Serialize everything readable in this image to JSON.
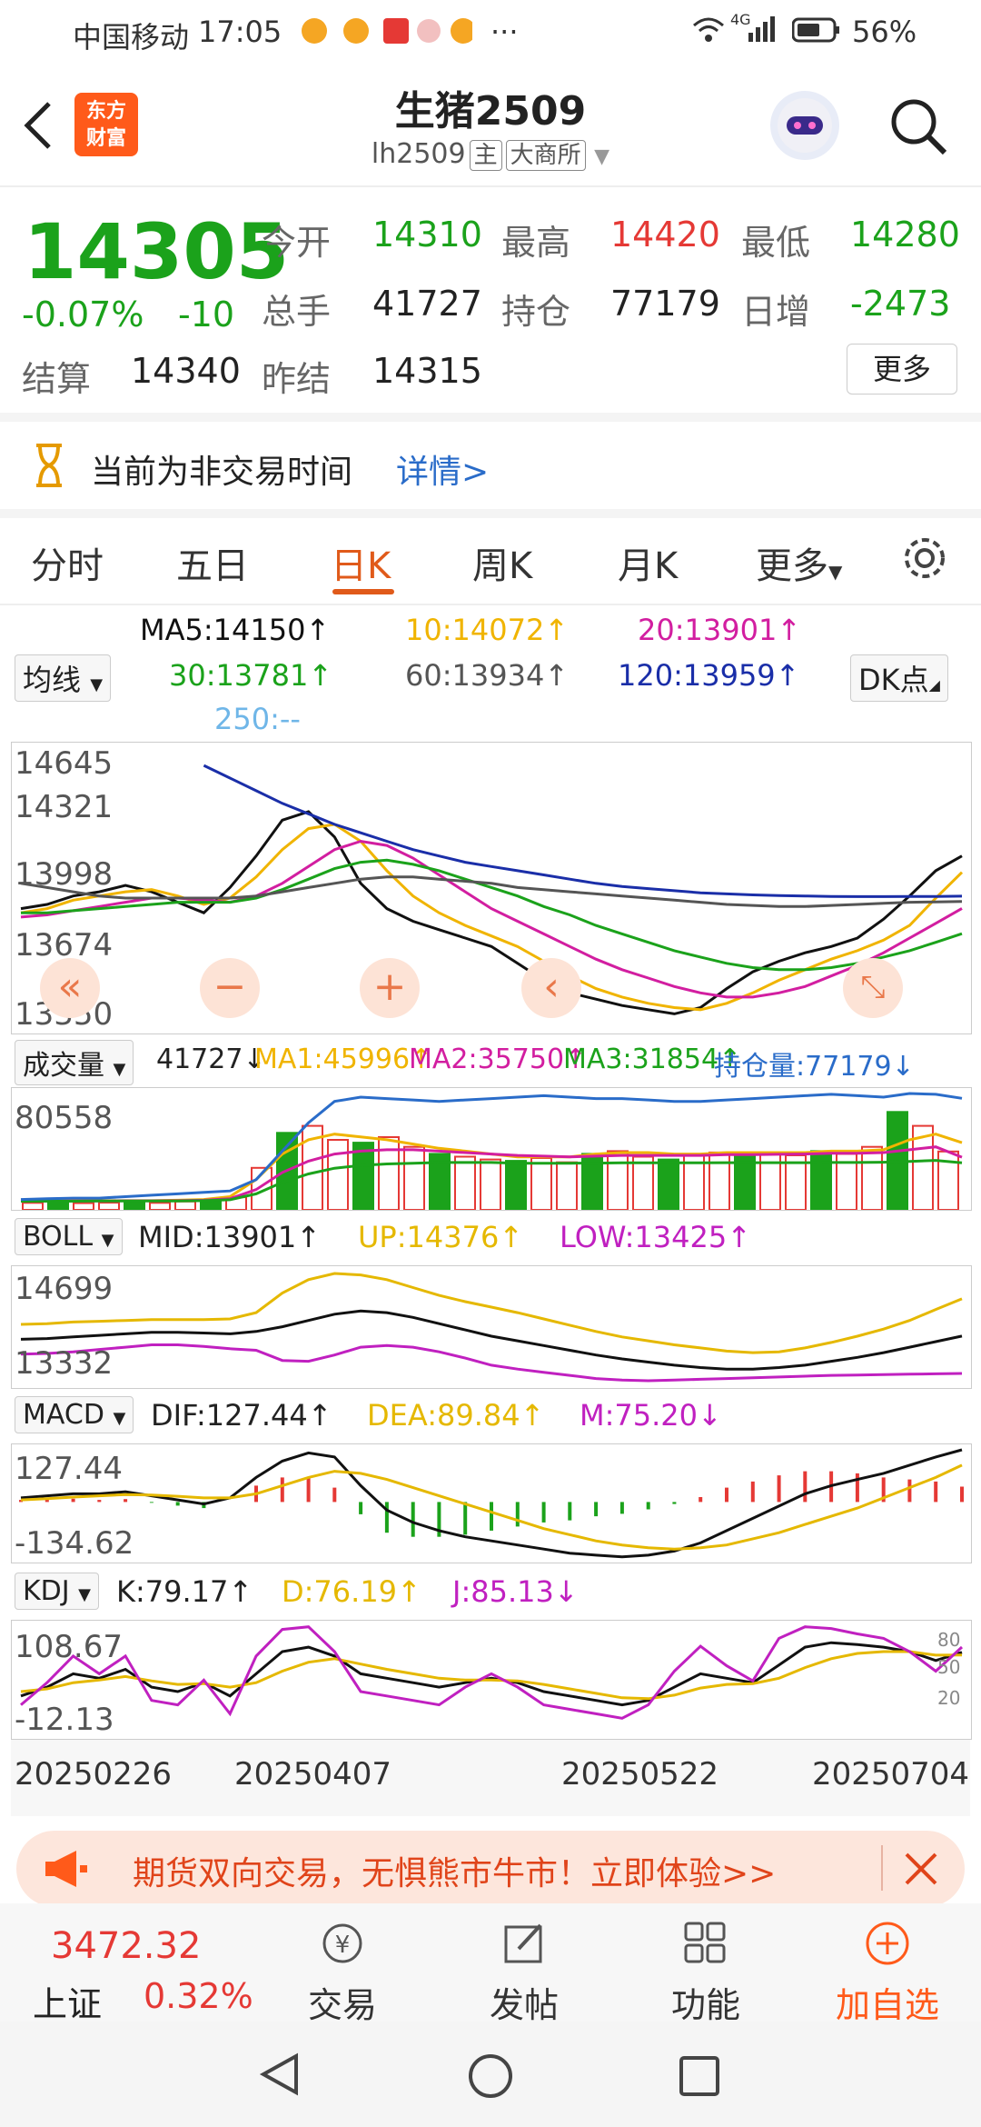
{
  "status_bar": {
    "carrier": "中国移动",
    "time": "17:05",
    "more": "···",
    "network": "4G",
    "battery": "56%"
  },
  "header": {
    "logo_line1": "东方",
    "logo_line2": "财富",
    "title": "生猪2509",
    "code": "lh2509",
    "tag_main": "主",
    "exchange": "大商所"
  },
  "quote": {
    "price": "14305",
    "change_pct": "-0.07%",
    "change": "-10",
    "open_label": "今开",
    "open": "14310",
    "high_label": "最高",
    "high": "14420",
    "low_label": "最低",
    "low": "14280",
    "volume_label": "总手",
    "volume": "41727",
    "oi_label": "持仓",
    "oi": "77179",
    "oi_chg_label": "日增",
    "oi_chg": "-2473",
    "settle_label": "结算",
    "settle": "14340",
    "prev_settle_label": "昨结",
    "prev_settle": "14315",
    "more_button": "更多"
  },
  "notice": {
    "text": "当前为非交易时间",
    "link": "详情>"
  },
  "tabs": [
    "分时",
    "五日",
    "日K",
    "周K",
    "月K",
    "更多"
  ],
  "active_tab": "日K",
  "ma": {
    "selector": "均线",
    "ma5": "MA5:14150↑",
    "ma10": "10:14072↑",
    "ma20": "20:13901↑",
    "ma30": "30:13781↑",
    "ma60": "60:13934↑",
    "ma120": "120:13959↑",
    "ma250": "250:--",
    "dk": "DK点",
    "colors": {
      "ma5": "#111111",
      "ma10": "#f0b400",
      "ma20": "#d21ea0",
      "ma30": "#1ba21b",
      "ma60": "#555555",
      "ma120": "#1a2ea8",
      "ma250": "#6fb6e8"
    }
  },
  "kline_axis": {
    "y_top": "14645",
    "y_2": "14321",
    "y_3": "13998",
    "y_4": "13674",
    "y_bottom": "13350"
  },
  "volume": {
    "selector": "成交量",
    "vol": "41727↓",
    "ma1": "MA1:45996↑",
    "ma2": "MA2:35750↑",
    "ma3": "MA3:31854↑",
    "oi": "持仓量:77179↓",
    "y_top": "80558"
  },
  "boll": {
    "selector": "BOLL",
    "mid": "MID:13901↑",
    "up": "UP:14376↑",
    "low": "LOW:13425↑",
    "y_top": "14699",
    "y_bottom": "13332"
  },
  "macd": {
    "selector": "MACD",
    "dif": "DIF:127.44↑",
    "dea": "DEA:89.84↑",
    "m": "M:75.20↓",
    "y_top": "127.44",
    "y_bottom": "-134.62"
  },
  "kdj": {
    "selector": "KDJ",
    "k": "K:79.17↑",
    "d": "D:76.19↑",
    "j": "J:85.13↓",
    "y_top": "108.67",
    "y_bottom": "-12.13",
    "r80": "80",
    "r50": "50",
    "r20": "20"
  },
  "x_dates": [
    "20250226",
    "20250407",
    "20250522",
    "20250704"
  ],
  "banner": {
    "text": "期货双向交易，无惧熊市牛市！立即体验>>"
  },
  "bottom_nav": {
    "index_value": "3472.32",
    "index_name": "上证",
    "index_change": "0.32%",
    "trade": "交易",
    "post": "发帖",
    "function": "功能",
    "add_fav": "加自选"
  },
  "chart_data": [
    {
      "type": "line",
      "title": "",
      "ylim": [
        13350,
        14645
      ],
      "x_ticks": [
        "20250226",
        "20250407",
        "20250522",
        "20250704"
      ],
      "series": [
        {
          "name": "MA5",
          "values": [
            13900,
            13920,
            13960,
            13980,
            14010,
            13980,
            13930,
            13880,
            14000,
            14150,
            14320,
            14360,
            14240,
            14020,
            13900,
            13840,
            13800,
            13760,
            13720,
            13640,
            13560,
            13500,
            13470,
            13440,
            13420,
            13400,
            13430,
            13520,
            13600,
            13650,
            13690,
            13720,
            13760,
            13850,
            13960,
            14080,
            14150
          ]
        },
        {
          "name": "10",
          "values": [
            13880,
            13900,
            13940,
            13960,
            13980,
            13990,
            13960,
            13920,
            13950,
            14050,
            14180,
            14280,
            14300,
            14220,
            14080,
            13960,
            13880,
            13820,
            13770,
            13720,
            13650,
            13580,
            13520,
            13480,
            13450,
            13430,
            13420,
            13450,
            13500,
            13560,
            13610,
            13660,
            13700,
            13750,
            13820,
            13950,
            14072
          ]
        },
        {
          "name": "20",
          "values": [
            13860,
            13870,
            13890,
            13910,
            13930,
            13950,
            13950,
            13940,
            13930,
            13960,
            14020,
            14100,
            14180,
            14220,
            14200,
            14140,
            14060,
            13980,
            13900,
            13840,
            13780,
            13720,
            13660,
            13610,
            13570,
            13530,
            13500,
            13480,
            13480,
            13500,
            13530,
            13580,
            13630,
            13690,
            13760,
            13830,
            13901
          ]
        },
        {
          "name": "30",
          "values": [
            13880,
            13880,
            13890,
            13900,
            13910,
            13920,
            13930,
            13930,
            13930,
            13950,
            13990,
            14040,
            14090,
            14120,
            14130,
            14110,
            14080,
            14040,
            14000,
            13960,
            13910,
            13870,
            13820,
            13780,
            13740,
            13700,
            13670,
            13640,
            13620,
            13610,
            13610,
            13620,
            13640,
            13670,
            13700,
            13740,
            13781
          ]
        },
        {
          "name": "60",
          "values": [
            14020,
            14000,
            13980,
            13960,
            13950,
            13950,
            13950,
            13950,
            13950,
            13960,
            13980,
            14000,
            14020,
            14040,
            14050,
            14050,
            14040,
            14030,
            14020,
            14000,
            13990,
            13980,
            13970,
            13960,
            13950,
            13940,
            13930,
            13920,
            13915,
            13910,
            13910,
            13915,
            13920,
            13925,
            13930,
            13932,
            13934
          ]
        },
        {
          "name": "120",
          "values": [
            null,
            null,
            null,
            null,
            null,
            null,
            null,
            14580,
            14520,
            14460,
            14400,
            14350,
            14300,
            14260,
            14220,
            14180,
            14150,
            14120,
            14100,
            14080,
            14060,
            14040,
            14020,
            14005,
            13995,
            13985,
            13975,
            13970,
            13965,
            13962,
            13960,
            13958,
            13957,
            13957,
            13958,
            13958,
            13959
          ]
        }
      ]
    },
    {
      "type": "bar",
      "title": "",
      "ylim": [
        0,
        80558
      ],
      "values": [
        5000,
        5200,
        4800,
        5100,
        5300,
        5000,
        6000,
        6500,
        9000,
        30000,
        55000,
        60000,
        50000,
        48000,
        52000,
        45000,
        40000,
        38000,
        36000,
        35000,
        37000,
        34000,
        40000,
        42000,
        38000,
        36000,
        39000,
        41000,
        38000,
        40000,
        39000,
        42000,
        40000,
        45000,
        70000,
        60000,
        41727
      ],
      "series": [
        {
          "name": "MA1",
          "values": [
            5200,
            5200,
            5100,
            5100,
            5200,
            5200,
            5500,
            6000,
            8000,
            20000,
            38000,
            48000,
            52000,
            50000,
            48000,
            45000,
            42000,
            40000,
            38000,
            36000,
            36000,
            36000,
            38000,
            39000,
            39000,
            38000,
            38000,
            39000,
            39000,
            39000,
            39000,
            40000,
            40000,
            41000,
            48000,
            52000,
            45996
          ]
        },
        {
          "name": "MA2",
          "values": [
            5000,
            5000,
            5000,
            5000,
            5100,
            5100,
            5200,
            5500,
            6500,
            13000,
            25000,
            33000,
            38000,
            40000,
            41000,
            41000,
            40000,
            39000,
            38000,
            37000,
            36500,
            36000,
            36500,
            37000,
            37000,
            37000,
            37000,
            37500,
            37500,
            37800,
            38000,
            38500,
            38500,
            39000,
            41000,
            43000,
            35750
          ]
        },
        {
          "name": "MA3",
          "values": [
            4800,
            4800,
            4800,
            4900,
            4900,
            5000,
            5000,
            5200,
            5800,
            10000,
            18000,
            24000,
            28000,
            30000,
            31000,
            31500,
            32000,
            32000,
            32000,
            31500,
            31500,
            31500,
            31600,
            31800,
            31800,
            31800,
            31800,
            31900,
            31900,
            31900,
            31900,
            32000,
            32000,
            32200,
            32800,
            33500,
            31854
          ]
        },
        {
          "name": "持仓量",
          "values": [
            6000,
            6500,
            7000,
            7000,
            8000,
            9000,
            10000,
            11000,
            12000,
            20000,
            40000,
            60000,
            75000,
            78000,
            77000,
            76000,
            75000,
            76000,
            77000,
            78000,
            79000,
            78000,
            77000,
            77000,
            76000,
            75000,
            75000,
            76000,
            77000,
            78000,
            79000,
            80000,
            79000,
            78000,
            80558,
            80000,
            77179
          ]
        }
      ]
    },
    {
      "type": "line",
      "title": "",
      "ylim": [
        13332,
        14699
      ],
      "series": [
        {
          "name": "MID",
          "values": [
            13860,
            13870,
            13890,
            13910,
            13930,
            13950,
            13950,
            13940,
            13930,
            13960,
            14020,
            14100,
            14180,
            14220,
            14200,
            14140,
            14060,
            13980,
            13900,
            13840,
            13780,
            13720,
            13660,
            13610,
            13570,
            13530,
            13500,
            13480,
            13480,
            13500,
            13530,
            13580,
            13630,
            13690,
            13760,
            13830,
            13901
          ]
        },
        {
          "name": "UP",
          "values": [
            14050,
            14060,
            14080,
            14090,
            14100,
            14110,
            14110,
            14110,
            14120,
            14200,
            14450,
            14620,
            14699,
            14680,
            14620,
            14520,
            14420,
            14340,
            14270,
            14200,
            14120,
            14040,
            13960,
            13890,
            13840,
            13790,
            13750,
            13710,
            13690,
            13700,
            13750,
            13820,
            13900,
            13990,
            14100,
            14240,
            14376
          ]
        },
        {
          "name": "LOW",
          "values": [
            13670,
            13680,
            13700,
            13730,
            13760,
            13790,
            13790,
            13770,
            13740,
            13720,
            13590,
            13580,
            13660,
            13760,
            13780,
            13760,
            13700,
            13620,
            13530,
            13480,
            13440,
            13400,
            13360,
            13340,
            13332,
            13340,
            13350,
            13360,
            13370,
            13380,
            13390,
            13400,
            13405,
            13410,
            13415,
            13420,
            13425
          ]
        }
      ]
    },
    {
      "type": "line",
      "title": "",
      "ylim": [
        -134.62,
        127.44
      ],
      "series": [
        {
          "name": "DIF",
          "values": [
            10,
            15,
            20,
            20,
            25,
            15,
            5,
            -5,
            10,
            60,
            100,
            120,
            110,
            40,
            -20,
            -50,
            -70,
            -85,
            -95,
            -105,
            -115,
            -125,
            -130,
            -134,
            -130,
            -120,
            -100,
            -70,
            -40,
            -10,
            20,
            40,
            55,
            70,
            90,
            110,
            127.44
          ]
        },
        {
          "name": "DEA",
          "values": [
            5,
            8,
            12,
            15,
            18,
            17,
            14,
            10,
            10,
            20,
            40,
            60,
            75,
            70,
            55,
            35,
            15,
            -5,
            -25,
            -45,
            -65,
            -80,
            -95,
            -105,
            -112,
            -115,
            -112,
            -105,
            -90,
            -75,
            -55,
            -35,
            -15,
            10,
            35,
            60,
            89.84
          ]
        },
        {
          "name": "M",
          "values": [
            10,
            14,
            16,
            10,
            14,
            -4,
            -18,
            -30,
            0,
            80,
            120,
            120,
            70,
            -60,
            -150,
            -170,
            -170,
            -160,
            -140,
            -120,
            -100,
            -90,
            -70,
            -58,
            -36,
            -10,
            24,
            70,
            100,
            130,
            150,
            150,
            140,
            120,
            110,
            100,
            75.2
          ]
        }
      ]
    },
    {
      "type": "line",
      "title": "",
      "ylim": [
        -12.13,
        108.67
      ],
      "series": [
        {
          "name": "K",
          "values": [
            30,
            40,
            55,
            50,
            60,
            40,
            35,
            45,
            30,
            55,
            80,
            85,
            75,
            55,
            50,
            45,
            40,
            45,
            50,
            45,
            35,
            30,
            25,
            20,
            25,
            40,
            55,
            50,
            45,
            65,
            85,
            90,
            88,
            85,
            80,
            70,
            79.17
          ]
        },
        {
          "name": "D",
          "values": [
            35,
            38,
            45,
            48,
            52,
            47,
            43,
            44,
            40,
            45,
            58,
            68,
            72,
            66,
            60,
            55,
            50,
            48,
            48,
            47,
            43,
            38,
            33,
            28,
            27,
            31,
            39,
            43,
            44,
            50,
            62,
            72,
            78,
            80,
            80,
            76,
            76.19
          ]
        },
        {
          "name": "J",
          "values": [
            20,
            45,
            75,
            55,
            75,
            25,
            20,
            48,
            10,
            75,
            105,
            108,
            80,
            35,
            30,
            25,
            20,
            40,
            55,
            40,
            20,
            15,
            10,
            5,
            20,
            58,
            86,
            64,
            47,
            95,
            108,
            106,
            100,
            95,
            80,
            58,
            85.13
          ]
        }
      ]
    }
  ]
}
